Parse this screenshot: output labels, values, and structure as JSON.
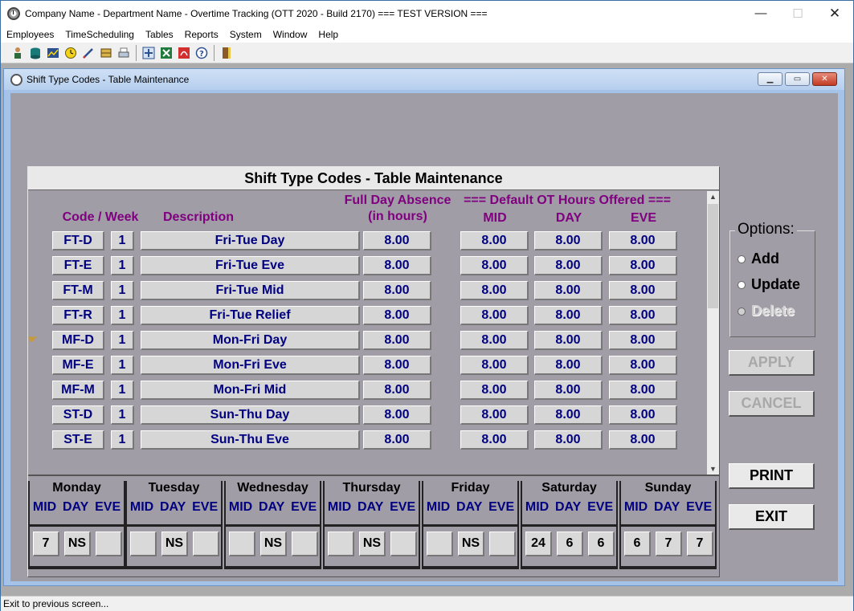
{
  "window": {
    "title": "Company Name - Department Name - Overtime Tracking (OTT 2020 - Build 2170) === TEST VERSION ===",
    "controls": {
      "minimize": "—",
      "maximize": "☐",
      "close": "✕"
    }
  },
  "menu": [
    "Employees",
    "TimeScheduling",
    "Tables",
    "Reports",
    "System",
    "Window",
    "Help"
  ],
  "toolbar": [
    "employee-icon",
    "database-icon",
    "chart-icon",
    "clock-icon",
    "pen-icon",
    "book-icon",
    "print-icon",
    "network-icon",
    "excel-icon",
    "pdf-icon",
    "help-icon",
    "exit-door-icon"
  ],
  "child": {
    "title": "Shift Type Codes - Table Maintenance",
    "controls": {
      "minimize": "▁",
      "maximize": "▭",
      "close": "✕"
    }
  },
  "panel": {
    "heading": "Shift Type Codes - Table Maintenance",
    "headers": {
      "code_week": "Code / Week",
      "description": "Description",
      "absence_line1": "Full Day Absence",
      "absence_line2": "(in hours)",
      "default_ot": "=== Default OT Hours Offered ===",
      "mid": "MID",
      "day": "DAY",
      "eve": "EVE"
    },
    "rows": [
      {
        "code": "FT-D",
        "week": "1",
        "description": "Fri-Tue Day",
        "absence": "8.00",
        "mid": "8.00",
        "day": "8.00",
        "eve": "8.00"
      },
      {
        "code": "FT-E",
        "week": "1",
        "description": "Fri-Tue Eve",
        "absence": "8.00",
        "mid": "8.00",
        "day": "8.00",
        "eve": "8.00"
      },
      {
        "code": "FT-M",
        "week": "1",
        "description": "Fri-Tue Mid",
        "absence": "8.00",
        "mid": "8.00",
        "day": "8.00",
        "eve": "8.00"
      },
      {
        "code": "FT-R",
        "week": "1",
        "description": "Fri-Tue Relief",
        "absence": "8.00",
        "mid": "8.00",
        "day": "8.00",
        "eve": "8.00"
      },
      {
        "code": "MF-D",
        "week": "1",
        "description": "Mon-Fri Day",
        "absence": "8.00",
        "mid": "8.00",
        "day": "8.00",
        "eve": "8.00"
      },
      {
        "code": "MF-E",
        "week": "1",
        "description": "Mon-Fri Eve",
        "absence": "8.00",
        "mid": "8.00",
        "day": "8.00",
        "eve": "8.00"
      },
      {
        "code": "MF-M",
        "week": "1",
        "description": "Mon-Fri Mid",
        "absence": "8.00",
        "mid": "8.00",
        "day": "8.00",
        "eve": "8.00"
      },
      {
        "code": "ST-D",
        "week": "1",
        "description": "Sun-Thu Day",
        "absence": "8.00",
        "mid": "8.00",
        "day": "8.00",
        "eve": "8.00"
      },
      {
        "code": "ST-E",
        "week": "1",
        "description": "Sun-Thu Eve",
        "absence": "8.00",
        "mid": "8.00",
        "day": "8.00",
        "eve": "8.00"
      }
    ],
    "scroll": {
      "up": "▲",
      "down": "▼"
    }
  },
  "week": {
    "shift_labels": [
      "MID",
      "DAY",
      "EVE"
    ],
    "days": [
      {
        "name": "Monday",
        "values": [
          "7",
          "NS",
          ""
        ]
      },
      {
        "name": "Tuesday",
        "values": [
          "",
          "NS",
          ""
        ]
      },
      {
        "name": "Wednesday",
        "values": [
          "",
          "NS",
          ""
        ]
      },
      {
        "name": "Thursday",
        "values": [
          "",
          "NS",
          ""
        ]
      },
      {
        "name": "Friday",
        "values": [
          "",
          "NS",
          ""
        ]
      },
      {
        "name": "Saturday",
        "values": [
          "24",
          "6",
          "6"
        ]
      },
      {
        "name": "Sunday",
        "values": [
          "6",
          "7",
          "7"
        ]
      }
    ]
  },
  "options": {
    "legend": "Options:",
    "add": "Add",
    "update": "Update",
    "delete": "Delete"
  },
  "buttons": {
    "apply": "APPLY",
    "cancel": "CANCEL",
    "print": "PRINT",
    "exit": "EXIT"
  },
  "status": "Exit to previous screen..."
}
